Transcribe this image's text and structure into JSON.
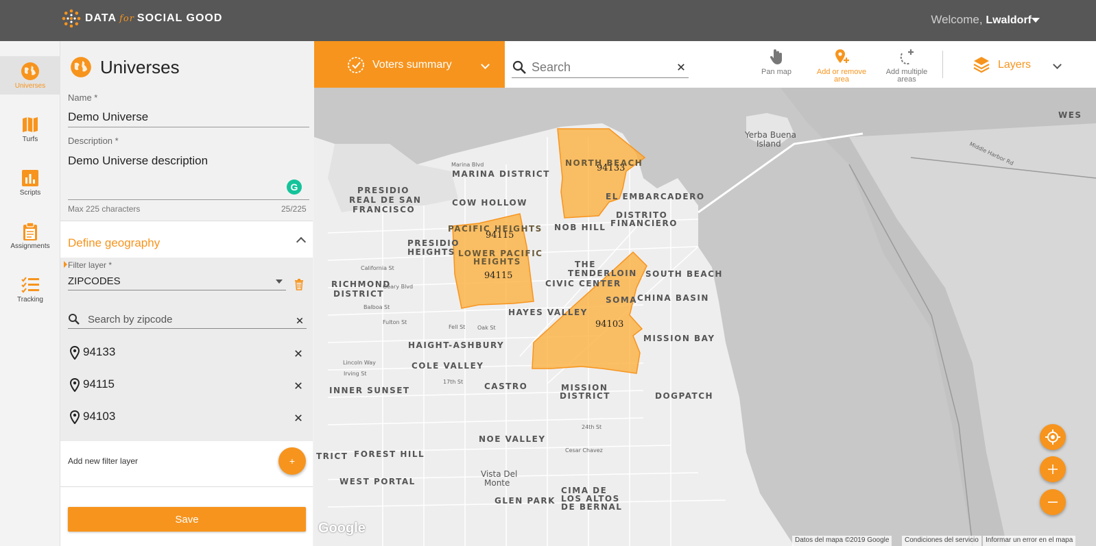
{
  "header": {
    "brand_left": "DATA",
    "brand_for": "for",
    "brand_right": "SOCIAL GOOD",
    "welcome_prefix": "Welcome,",
    "user_name": "Lwaldorf"
  },
  "nav": [
    {
      "label": "Universes",
      "icon": "globe-icon",
      "active": true
    },
    {
      "label": "Turfs",
      "icon": "map-icon",
      "active": false
    },
    {
      "label": "Scripts",
      "icon": "bar-chart-icon",
      "active": false
    },
    {
      "label": "Assignments",
      "icon": "clipboard-icon",
      "active": false
    },
    {
      "label": "Tracking",
      "icon": "checklist-icon",
      "active": false
    }
  ],
  "panel": {
    "title": "Universes",
    "name_label": "Name *",
    "name_value": "Demo Universe",
    "description_label": "Description *",
    "description_value": "Demo Universe description",
    "description_hint": "Max 225 characters",
    "description_count": "25/225",
    "geography_title": "Define geography",
    "filter_layer_label": "Filter layer *",
    "filter_layer_value": "ZIPCODES",
    "zip_search_placeholder": "Search by zipcode",
    "zipcodes": [
      "94133",
      "94115",
      "94103"
    ],
    "add_filter_label": "Add new filter layer",
    "add_button": "+",
    "save_label": "Save"
  },
  "map": {
    "voters_summary_label": "Voters summary",
    "search_placeholder": "Search",
    "tools": {
      "pan": "Pan map",
      "add_remove_line1": "Add or remove",
      "add_remove_line2": "area",
      "add_multiple_line1": "Add multiple",
      "add_multiple_line2": "areas"
    },
    "layers_label": "Layers",
    "zip_labels": {
      "z94133": "94133",
      "z94115a": "94115",
      "z94115b": "94115",
      "z94103": "94103"
    },
    "place_labels": {
      "yerba1": "Yerba Buena",
      "yerba2": "Island",
      "marina_district": "MARINA DISTRICT",
      "marina_blvd": "Marina Blvd",
      "north_beach": "NORTH BEACH",
      "presidio1": "PRESIDIO",
      "presidio2": "REAL DE SAN",
      "presidio3": "FRANCISCO",
      "cow_hollow": "COW HOLLOW",
      "el_embarcadero": "EL EMBARCADERO",
      "distrito1": "DISTRITO",
      "distrito2": "FINANCIERO",
      "pacific_heights": "PACIFIC HEIGHTS",
      "nob_hill": "NOB HILL",
      "presidio_heights1": "PRESIDIO",
      "presidio_heights2": "HEIGHTS",
      "lower_pacific1": "LOWER PACIFIC",
      "lower_pacific2": "HEIGHTS",
      "tenderloin1": "THE",
      "tenderloin2": "TENDERLOIN",
      "south_beach": "SOUTH BEACH",
      "richmond1": "RICHMOND",
      "richmond2": "DISTRICT",
      "civic_center": "CIVIC CENTER",
      "soma": "SOMA",
      "china_basin": "CHINA BASIN",
      "hayes_valley": "HAYES VALLEY",
      "mission_bay": "MISSION BAY",
      "haight_ashbury": "HAIGHT-ASHBURY",
      "cole_valley": "COLE VALLEY",
      "inner_sunset": "INNER SUNSET",
      "castro": "CASTRO",
      "mission_district1": "MISSION",
      "mission_district2": "DISTRICT",
      "dogpatch": "DOGPATCH",
      "noe_valley": "NOE VALLEY",
      "forest_hill": "FOREST HILL",
      "trict": "TRICT",
      "west_portal": "WEST PORTAL",
      "vista1": "Vista Del",
      "vista2": "Monte",
      "glen_park": "GLEN PARK",
      "cima1": "CIMA DE",
      "cima2": "LOS ALTOS",
      "cima3": "DE BERNAL",
      "california_st": "California St",
      "geary_blvd": "Geary Blvd",
      "balboa_st": "Balboa St",
      "fulton_st": "Fulton St",
      "fell_st": "Fell St",
      "oak_st": "Oak St",
      "lincoln_way": "Lincoln Way",
      "irving_st": "Irving St",
      "17th_st": "17th St",
      "24th_st": "24th St",
      "cesar_chavez": "Cesar Chavez",
      "middle_harbor": "Middle Harbor Rd",
      "wes": "WES"
    },
    "google": "Google",
    "attrib_data": "Datos del mapa ©2019 Google",
    "attrib_terms": "Condiciones del servicio",
    "attrib_report": "Informar un error en el mapa",
    "zoom_in": "+",
    "zoom_out": "−"
  },
  "colors": {
    "accent": "#f7941d",
    "topbar": "#575757",
    "zip_fill": "#fbb040"
  }
}
